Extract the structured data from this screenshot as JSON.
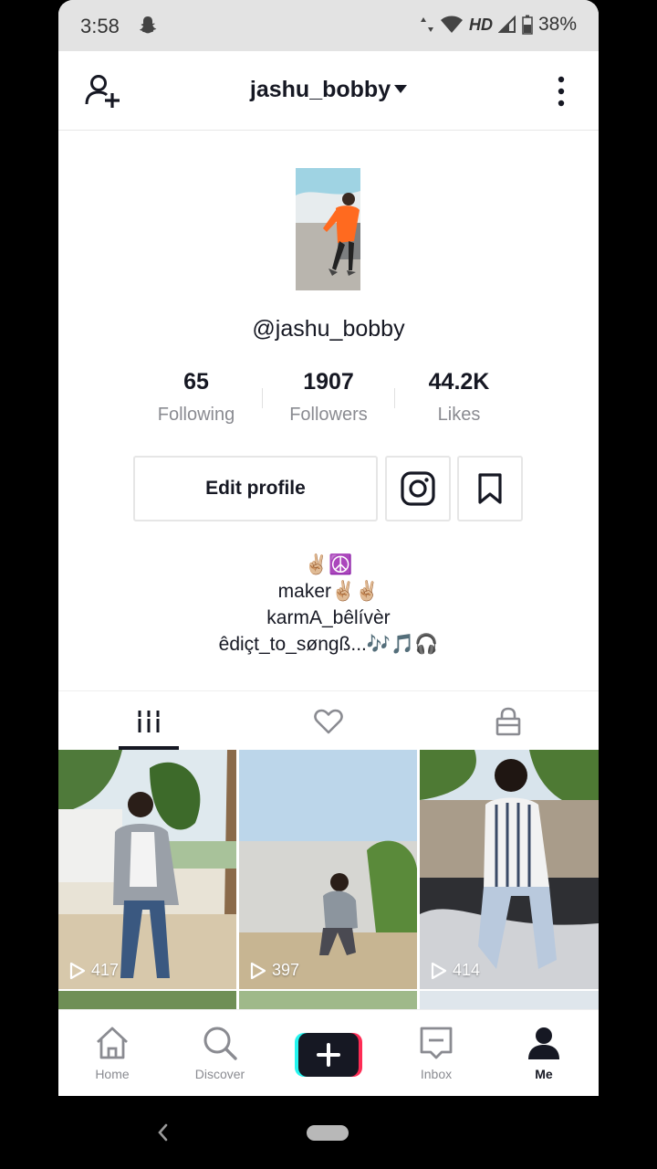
{
  "status_bar": {
    "time": "3:58",
    "network": "HD",
    "battery": "38%"
  },
  "header": {
    "username": "jashu_bobby"
  },
  "profile": {
    "handle": "@jashu_bobby",
    "stats": [
      {
        "value": "65",
        "label": "Following"
      },
      {
        "value": "1907",
        "label": "Followers"
      },
      {
        "value": "44.2K",
        "label": "Likes"
      }
    ],
    "edit_label": "Edit profile",
    "bio": [
      "✌🏼☮️",
      "maker✌🏼✌🏼",
      "karmA_bêlívèr",
      "êdiçt_to_søngß...🎶🎵🎧"
    ]
  },
  "videos": [
    {
      "views": "417"
    },
    {
      "views": "397"
    },
    {
      "views": "414"
    }
  ],
  "nav": {
    "home": "Home",
    "discover": "Discover",
    "inbox": "Inbox",
    "me": "Me"
  },
  "colors": {
    "accent_cyan": "#25f4ee",
    "accent_pink": "#fe2c55",
    "text": "#161823",
    "muted": "#8a8b91"
  }
}
